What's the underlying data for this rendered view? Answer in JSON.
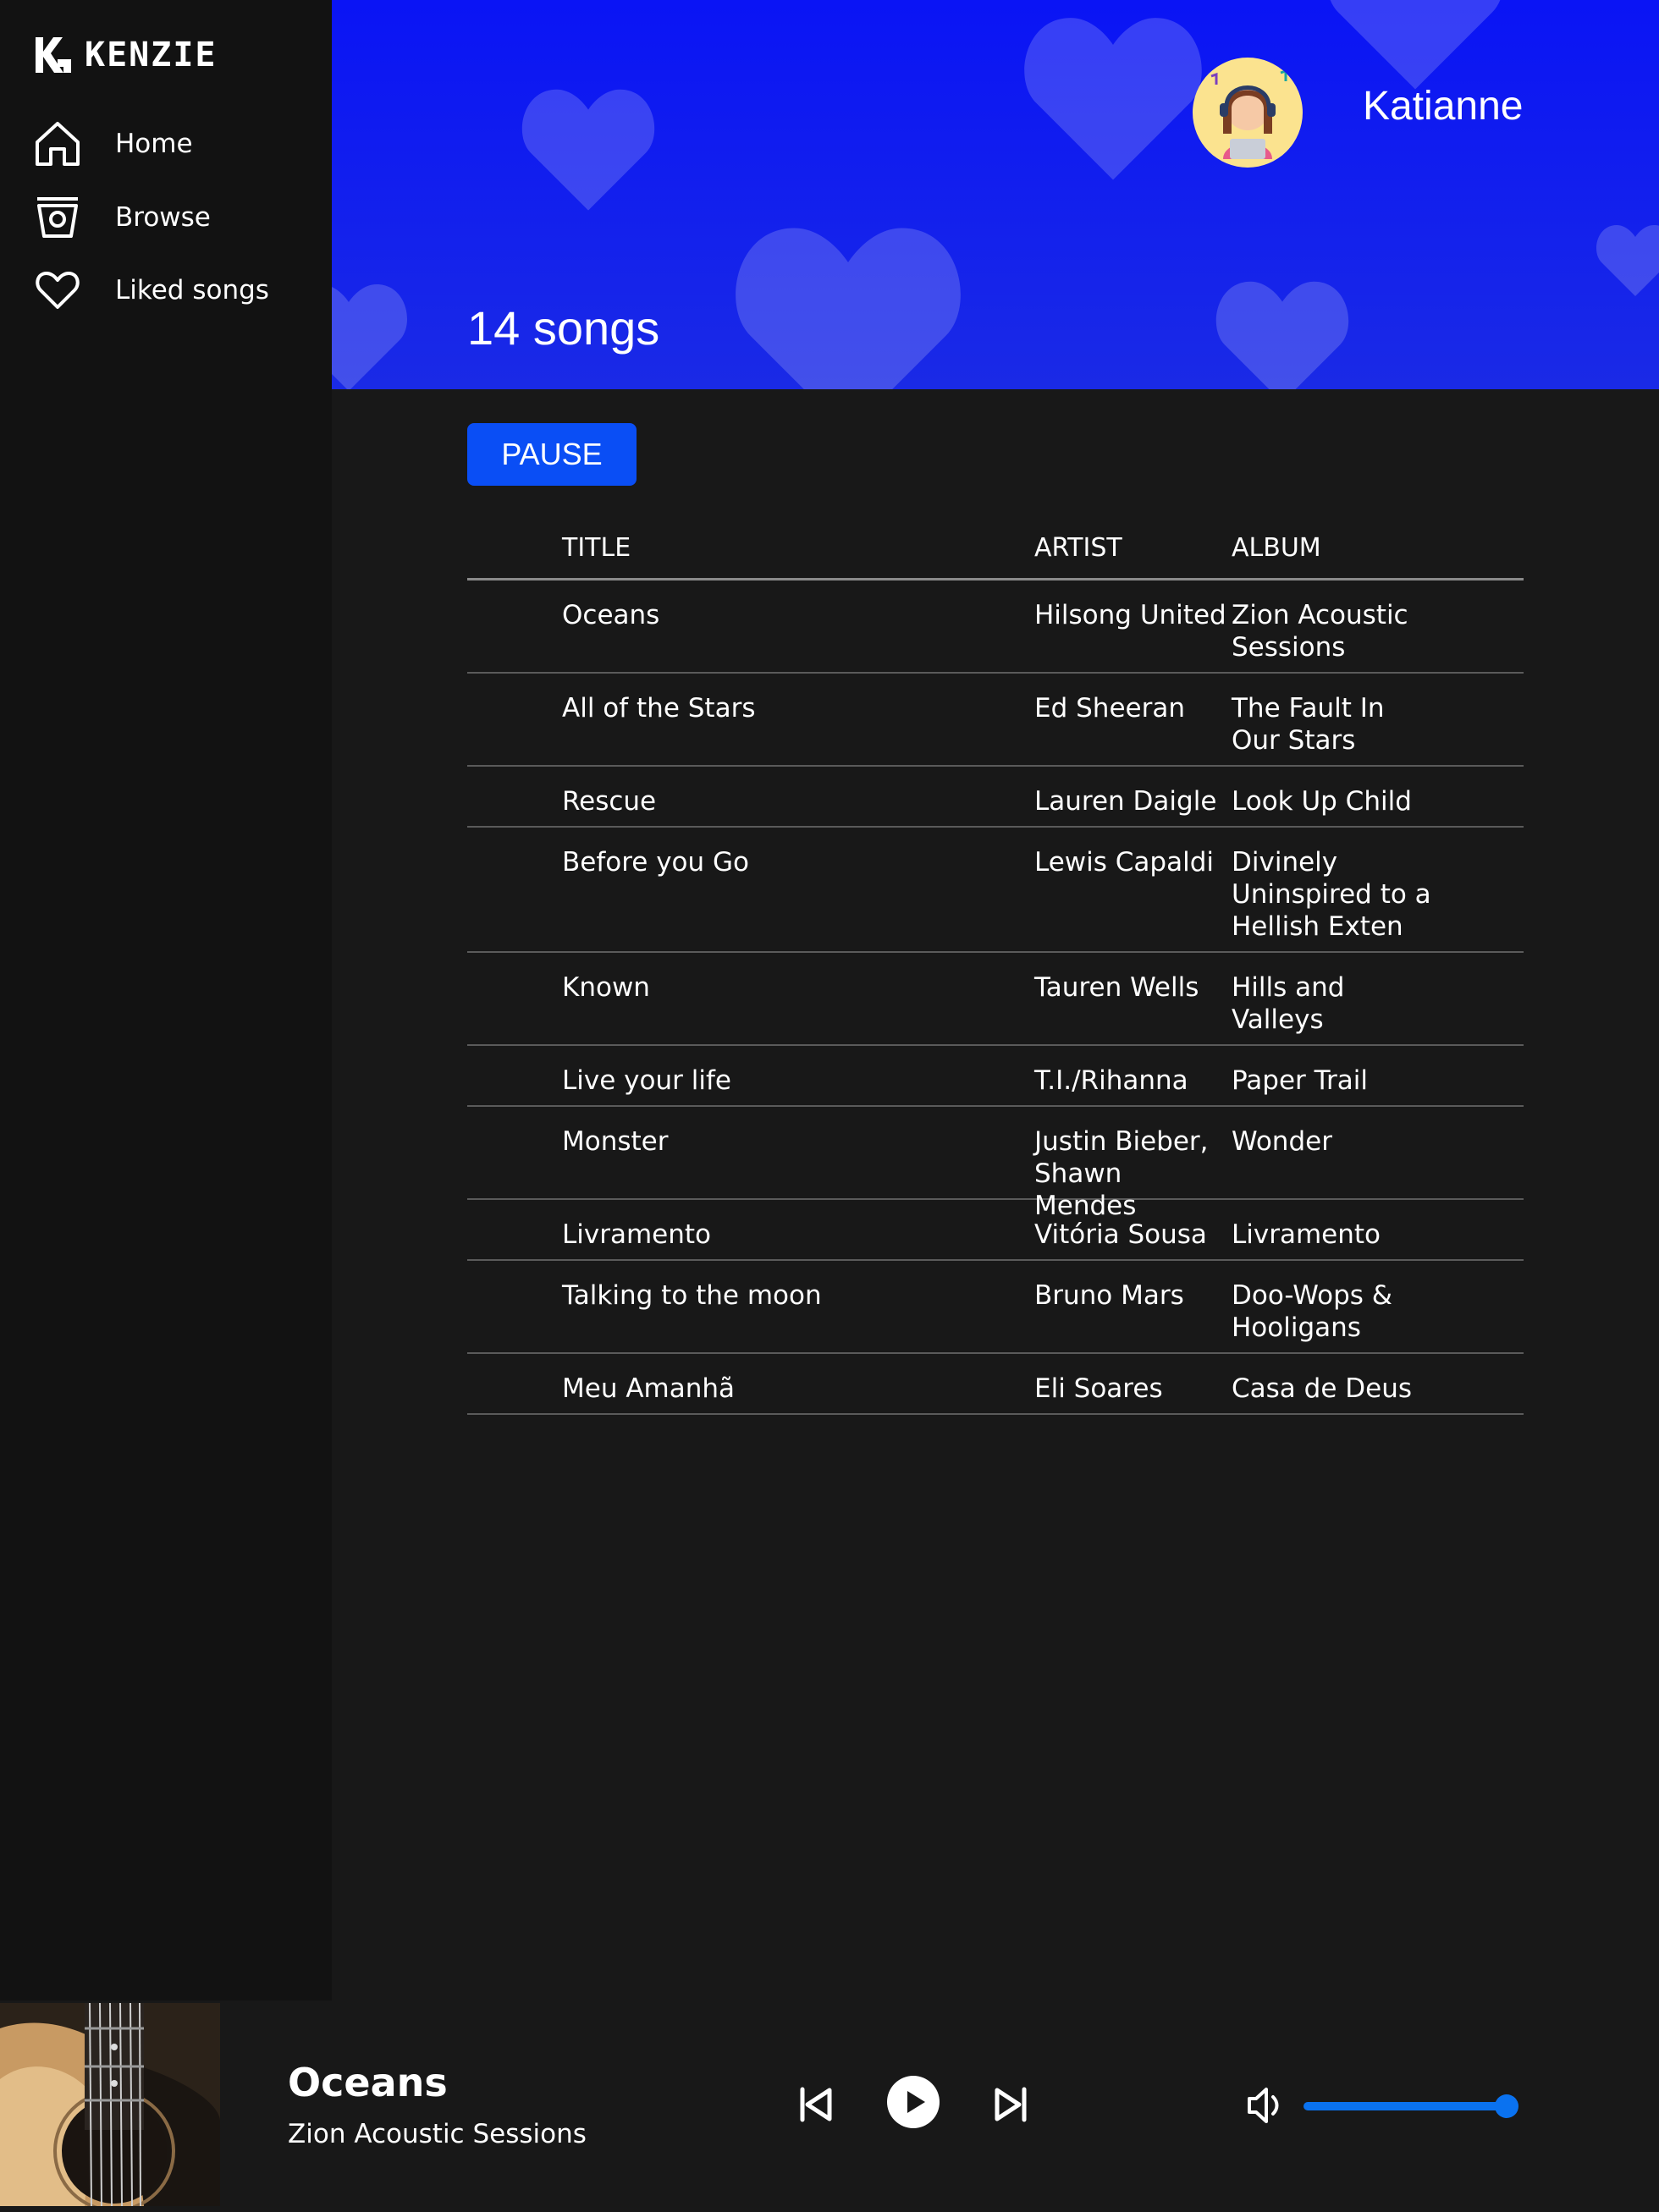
{
  "app": {
    "logo_text": "KENZIE"
  },
  "sidebar": {
    "items": [
      {
        "label": "Home",
        "icon": "home-icon"
      },
      {
        "label": "Browse",
        "icon": "browse-icon"
      },
      {
        "label": "Liked songs",
        "icon": "heart-icon"
      }
    ]
  },
  "header": {
    "username": "Katianne",
    "song_count": "14 songs",
    "banner_color": "#0a14f5"
  },
  "main": {
    "pause_label": "PAUSE",
    "columns": {
      "title": "TITLE",
      "artist": "ARTIST",
      "album": "ALBUM"
    },
    "rows": [
      {
        "title": "Oceans",
        "artist": "Hilsong United",
        "album": "Zion Acoustic Sessions"
      },
      {
        "title": "All of the Stars",
        "artist": "Ed Sheeran",
        "album": "The Fault In Our Stars"
      },
      {
        "title": "Rescue",
        "artist": "Lauren Daigle",
        "album": "Look Up Child"
      },
      {
        "title": "Before you Go",
        "artist": "Lewis Capaldi",
        "album": "Divinely Uninspired to a Hellish Exten"
      },
      {
        "title": "Known",
        "artist": "Tauren Wells",
        "album": "Hills and Valleys"
      },
      {
        "title": "Live your life",
        "artist": "T.I./Rihanna",
        "album": "Paper Trail"
      },
      {
        "title": "Monster",
        "artist": "Justin Bieber, Shawn Mendes",
        "album": "Wonder"
      },
      {
        "title": "Livramento",
        "artist": "Vitória Sousa",
        "album": "Livramento"
      },
      {
        "title": "Talking to the moon",
        "artist": "Bruno Mars",
        "album": "Doo-Wops & Hooligans"
      },
      {
        "title": "Meu Amanhã",
        "artist": "Eli Soares",
        "album": "Casa de Deus"
      }
    ]
  },
  "player": {
    "title": "Oceans",
    "album": "Zion Acoustic Sessions",
    "volume": 1.0,
    "accent": "#0a72f0"
  }
}
